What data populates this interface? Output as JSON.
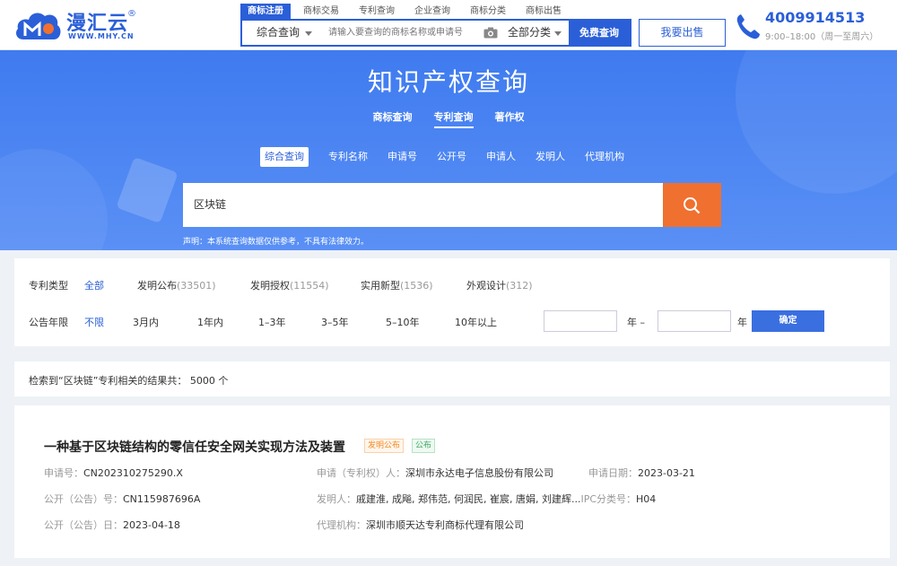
{
  "header": {
    "logo_name": "漫汇云",
    "logo_reg": "®",
    "logo_url": "WWW.MHY.CN",
    "nav_tabs": [
      "商标注册",
      "商标交易",
      "专利查询",
      "企业查询",
      "商标分类",
      "商标出售"
    ],
    "search_type": "综合查询",
    "search_placeholder": "请输入要查询的商标名称或申请号",
    "category": "全部分类",
    "free_search": "免费查询",
    "sell_button": "我要出售",
    "phone": "4009914513",
    "hours": "9:00–18:00（周一至周六）"
  },
  "hero": {
    "title": "知识产权查询",
    "tabs": [
      "商标查询",
      "专利查询",
      "著作权"
    ],
    "subtabs": [
      "综合查询",
      "专利名称",
      "申请号",
      "公开号",
      "申请人",
      "发明人",
      "代理机构"
    ],
    "query": "区块链",
    "disclaimer": "声明：本系统查询数据仅供参考，不具有法律效力。"
  },
  "filters": {
    "type_label": "专利类型",
    "types": [
      {
        "name": "全部",
        "count": ""
      },
      {
        "name": "发明公布",
        "count": "(33501)"
      },
      {
        "name": "发明授权",
        "count": "(11554)"
      },
      {
        "name": "实用新型",
        "count": "(1536)"
      },
      {
        "name": "外观设计",
        "count": "(312)"
      }
    ],
    "year_label": "公告年限",
    "years": [
      "不限",
      "3月内",
      "1年内",
      "1–3年",
      "3–5年",
      "5–10年",
      "10年以上"
    ],
    "year_from_suffix": "年 –",
    "year_to_suffix": "年",
    "confirm": "确定"
  },
  "results": {
    "summary": "检索到“区块链”专利相关的结果共：  5000 个"
  },
  "card": {
    "title": "一种基于区块链结构的零信任安全网关实现方法及装置",
    "badges": [
      "发明公布",
      "公布"
    ],
    "application_no_label": "申请号：",
    "application_no": "CN202310275290.X",
    "applicant_label": "申请（专利权）人：",
    "applicant": "深圳市永达电子信息股份有限公司",
    "apply_date_label": "申请日期：",
    "apply_date": "2023-03-21",
    "pub_no_label": "公开（公告）号：",
    "pub_no": "CN115987696A",
    "inventor_label": "发明人：",
    "inventors": "戚建淮, 成飚, 郑伟范, 何润民, 崔宸, 唐娟, 刘建辉...",
    "ipc_label": "IPC分类号：",
    "ipc": "H04",
    "pub_date_label": "公开（公告）日：",
    "pub_date": "2023-04-18",
    "agency_label": "代理机构：",
    "agency": "深圳市顺天达专利商标代理有限公司"
  },
  "colors": {
    "brand": "#2b5fd8",
    "search_button": "#f07030",
    "badge_orange": "#f08a24",
    "badge_green": "#3aa960"
  }
}
